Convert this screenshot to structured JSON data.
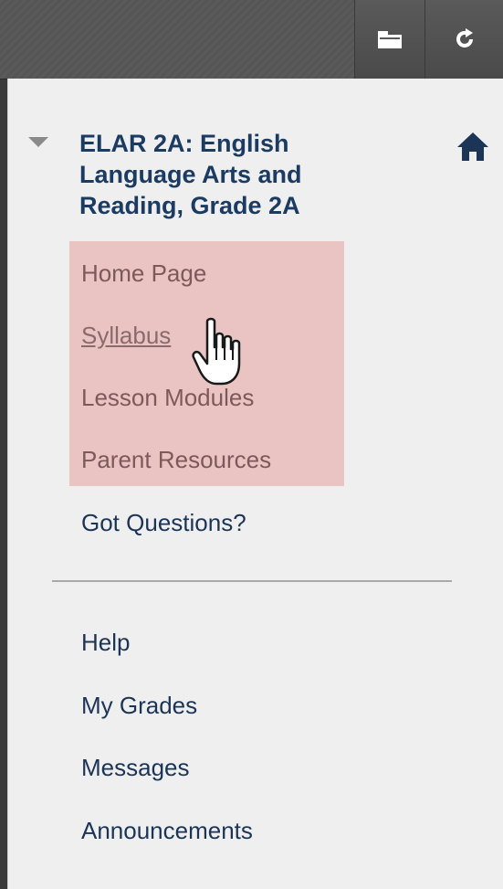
{
  "toolbar": {
    "folder_icon": "folder-icon",
    "refresh_icon": "refresh-icon"
  },
  "course": {
    "title": "ELAR 2A: English Language Arts and Reading, Grade 2A",
    "collapse_icon": "triangle-down-icon",
    "home_icon": "home-icon"
  },
  "course_menu": {
    "highlighted_color": "#eac3c3",
    "items": [
      {
        "label": "Home Page"
      },
      {
        "label": "Syllabus",
        "hovered": true
      },
      {
        "label": "Lesson Modules"
      },
      {
        "label": "Parent Resources"
      },
      {
        "label": "Got Questions?"
      }
    ]
  },
  "tools_menu": {
    "items": [
      {
        "label": "Help"
      },
      {
        "label": "My Grades"
      },
      {
        "label": "Messages"
      },
      {
        "label": "Announcements"
      }
    ]
  },
  "colors": {
    "link_dark": "#1c3456",
    "link_muted": "#7d5a5a",
    "title": "#1c3b63",
    "panel_bg": "#efefef"
  }
}
